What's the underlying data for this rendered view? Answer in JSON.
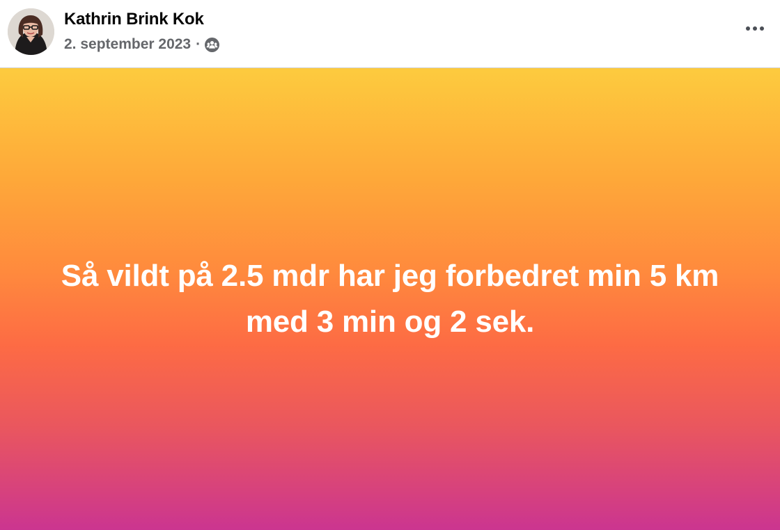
{
  "post": {
    "author_name": "Kathrin Brink Kok",
    "date": "2. september 2023",
    "separator": "·",
    "audience_icon": "friends-icon",
    "more_icon": "more-options-icon",
    "status_text": "Så vildt på 2.5 mdr har jeg forbedret min 5 km med 3 min og 2 sek."
  },
  "colors": {
    "author_name": "#050505",
    "meta_text": "#65676b",
    "gradient_top": "#fdcb3e",
    "gradient_middle": "#fd6b44",
    "gradient_bottom": "#cb3590",
    "status_text": "#ffffff"
  }
}
